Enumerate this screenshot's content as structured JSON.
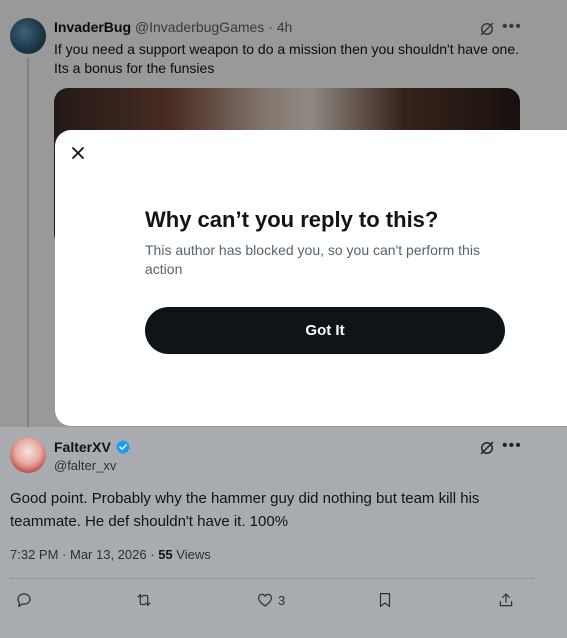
{
  "tweet1": {
    "name": "InvaderBug",
    "handle": "@InvaderbugGames",
    "separator": "·",
    "time": "4h",
    "text_line1": "If you need a support weapon to do a mission then you shouldn't have one.",
    "text_line2": "Its a bonus for the funsies"
  },
  "modal": {
    "title": "Why can’t you reply to this?",
    "description": "This author has blocked you, so you can't perform this action",
    "button_label": "Got It"
  },
  "tweet2": {
    "name": "FalterXV",
    "handle": "@falter_xv",
    "text": "Good point. Probably why the hammer guy did nothing but team kill his teammate. He def shouldn't have it. 100%",
    "time": "7:32 PM",
    "date": "Mar 13, 2026",
    "views_count": "55",
    "views_label": "Views",
    "likes": "3",
    "verified_color": "#1d9bf0"
  },
  "icons": [
    "grok-icon",
    "more-icon",
    "close-icon",
    "verified-badge-icon",
    "reply-icon",
    "retweet-icon",
    "like-icon",
    "bookmark-icon",
    "share-icon"
  ]
}
